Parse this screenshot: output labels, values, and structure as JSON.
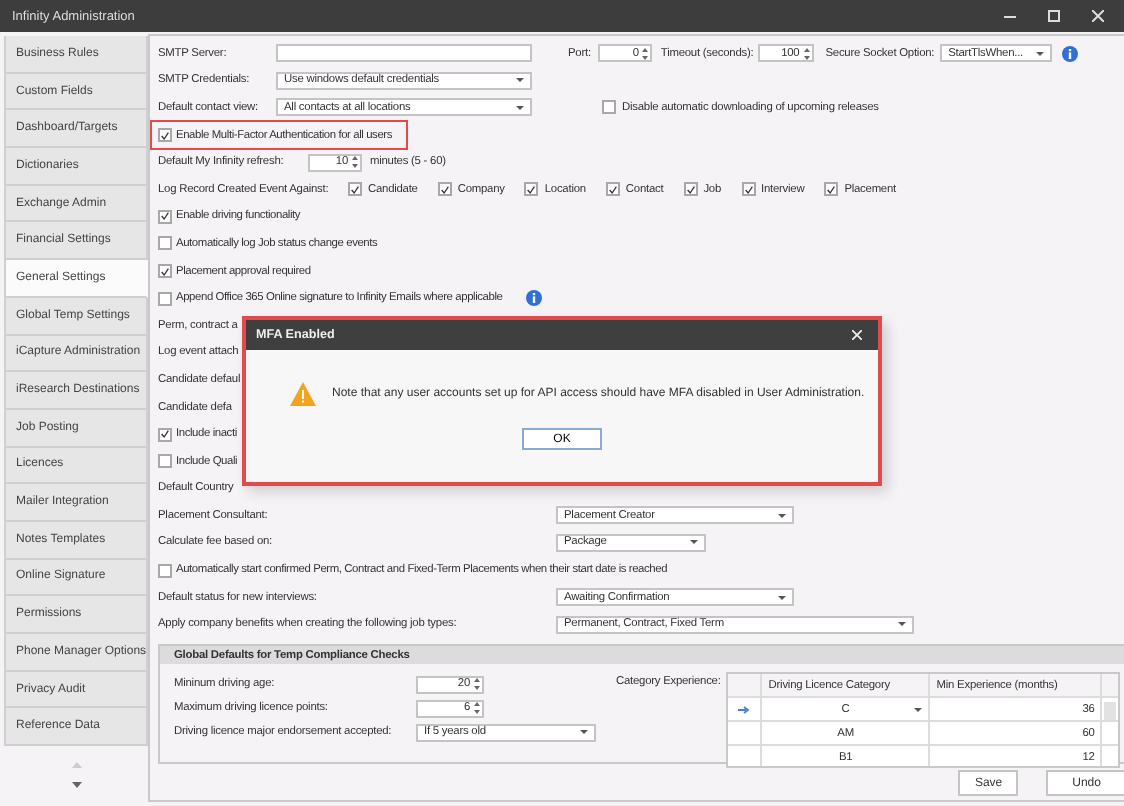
{
  "window": {
    "title": "Infinity Administration"
  },
  "sidebar": [
    {
      "label": "Business Rules",
      "selected": false
    },
    {
      "label": "Custom Fields",
      "selected": false
    },
    {
      "label": "Dashboard/Targets",
      "selected": false
    },
    {
      "label": "Dictionaries",
      "selected": false
    },
    {
      "label": "Exchange Admin",
      "selected": false
    },
    {
      "label": "Financial Settings",
      "selected": false
    },
    {
      "label": "General Settings",
      "selected": true
    },
    {
      "label": "Global Temp Settings",
      "selected": false
    },
    {
      "label": "iCapture Administration",
      "selected": false
    },
    {
      "label": "iResearch Destinations",
      "selected": false
    },
    {
      "label": "Job Posting",
      "selected": false
    },
    {
      "label": "Licences",
      "selected": false
    },
    {
      "label": "Mailer Integration",
      "selected": false
    },
    {
      "label": "Notes Templates",
      "selected": false
    },
    {
      "label": "Online Signature",
      "selected": false
    },
    {
      "label": "Permissions",
      "selected": false
    },
    {
      "label": "Phone Manager Options",
      "selected": false
    },
    {
      "label": "Privacy Audit",
      "selected": false
    },
    {
      "label": "Reference Data",
      "selected": false
    }
  ],
  "rows": [
    {
      "kind": "smtp",
      "label": "SMTP Server:",
      "port_label": "Port:",
      "port": "0",
      "timeout_label": "Timeout (seconds):",
      "timeout": "100",
      "socket_label": "Secure Socket Option:",
      "socket": "StartTlsWhen..."
    },
    {
      "kind": "select",
      "label": "SMTP Credentials:",
      "value": "Use windows default credentials"
    },
    {
      "kind": "select-check",
      "label": "Default contact view:",
      "value": "All contacts at all locations",
      "check_label": "Disable automatic downloading of upcoming releases",
      "checked": false
    },
    {
      "kind": "checkbox",
      "label": "Enable Multi-Factor Authentication for all users",
      "checked": true,
      "highlighted": true
    },
    {
      "kind": "spin",
      "label": "Default My Infinity refresh:",
      "value": "10",
      "unit": "minutes (5 - 60)"
    },
    {
      "kind": "checkgroup",
      "label": "Log Record Created Event Against:",
      "options": [
        {
          "label": "Candidate",
          "checked": true
        },
        {
          "label": "Company",
          "checked": true
        },
        {
          "label": "Location",
          "checked": true
        },
        {
          "label": "Contact",
          "checked": true
        },
        {
          "label": "Job",
          "checked": true
        },
        {
          "label": "Interview",
          "checked": true
        },
        {
          "label": "Placement",
          "checked": true
        }
      ]
    },
    {
      "kind": "checkbox",
      "label": "Enable driving functionality",
      "checked": true,
      "highlighted": false
    },
    {
      "kind": "checkbox",
      "label": "Automatically log Job status change events",
      "checked": false,
      "highlighted": false
    },
    {
      "kind": "checkbox",
      "label": "Placement approval required",
      "checked": true,
      "highlighted": false
    },
    {
      "kind": "checkbox",
      "label": "Append Office 365 Online signature to Infinity Emails where applicable",
      "checked": false,
      "highlighted": false,
      "info": true
    },
    {
      "kind": "text",
      "label": "Perm, contract a"
    },
    {
      "kind": "text",
      "label": "Log event attach"
    },
    {
      "kind": "text",
      "label": "Candidate defaul"
    },
    {
      "kind": "text",
      "label": "Candidate defa"
    },
    {
      "kind": "checkbox",
      "label": "Include inacti",
      "checked": true,
      "highlighted": false
    },
    {
      "kind": "checkbox",
      "label": "Include Quali",
      "checked": false,
      "highlighted": false
    },
    {
      "kind": "text",
      "label": "Default Country"
    },
    {
      "kind": "select",
      "label": "Placement Consultant:",
      "value": "Placement Creator"
    },
    {
      "kind": "select",
      "label": "Calculate fee based on:",
      "value": "Package"
    },
    {
      "kind": "checkbox",
      "label": "Automatically start confirmed Perm, Contract and Fixed-Term Placements when their start date is reached",
      "checked": false,
      "highlighted": false
    },
    {
      "kind": "select",
      "label": "Default status for new interviews:",
      "value": "Awaiting Confirmation"
    },
    {
      "kind": "select",
      "label": "Apply company benefits when creating the following job types:",
      "value": "Permanent, Contract, Fixed Term"
    }
  ],
  "group": {
    "title": "Global Defaults for Temp Compliance Checks",
    "fields": [
      {
        "kind": "spin",
        "label": "Mininum driving age:",
        "value": "20"
      },
      {
        "kind": "spin",
        "label": "Maximum driving licence points:",
        "value": "6"
      },
      {
        "kind": "select",
        "label": "Driving licence major endorsement accepted:",
        "value": "If 5 years old"
      }
    ],
    "category_label": "Category Experience:",
    "grid": {
      "columns": [
        "Driving Licence Category",
        "Min Experience (months)"
      ],
      "rows": [
        {
          "category": "C",
          "months": "36",
          "current": true
        },
        {
          "category": "AM",
          "months": "60",
          "current": false
        },
        {
          "category": "B1",
          "months": "12",
          "current": false
        }
      ]
    }
  },
  "buttons": [
    "Save",
    "Undo"
  ],
  "dialog": {
    "title": "MFA Enabled",
    "message": "Note that any user accounts set up for API access should have MFA disabled in User Administration.",
    "button": "OK"
  }
}
